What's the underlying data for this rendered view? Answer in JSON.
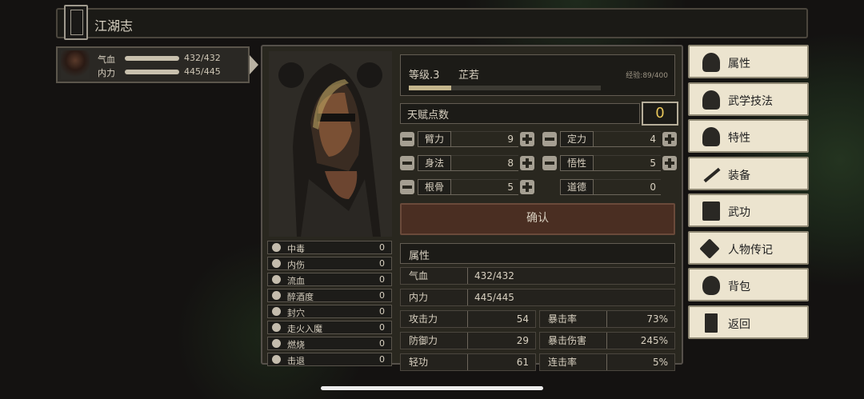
{
  "title": "江湖志",
  "character": {
    "hp_label": "气血",
    "hp_value": "432/432",
    "mp_label": "内力",
    "mp_value": "445/445"
  },
  "level": {
    "label": "等级.3",
    "name": "芷若",
    "exp": "经验:89/400",
    "exp_fraction": 0.2225
  },
  "talent": {
    "label": "天赋点数",
    "value": "0"
  },
  "attributes": [
    {
      "label": "臂力",
      "value": "9"
    },
    {
      "label": "定力",
      "value": "4"
    },
    {
      "label": "身法",
      "value": "8"
    },
    {
      "label": "悟性",
      "value": "5"
    },
    {
      "label": "根骨",
      "value": "5"
    },
    {
      "label": "道德",
      "value": "0"
    }
  ],
  "confirm": "确认",
  "section": "属性",
  "stats": {
    "hp_label": "气血",
    "hp": "432/432",
    "mp_label": "内力",
    "mp": "445/445",
    "attack_label": "攻击力",
    "attack": "54",
    "crit_label": "暴击率",
    "crit": "73%",
    "defense_label": "防御力",
    "defense": "29",
    "critdmg_label": "暴击伤害",
    "critdmg": "245%",
    "speed_label": "轻功",
    "speed": "61",
    "combo_label": "连击率",
    "combo": "5%"
  },
  "statuses": [
    {
      "name": "中毒",
      "value": "0"
    },
    {
      "name": "内伤",
      "value": "0"
    },
    {
      "name": "流血",
      "value": "0"
    },
    {
      "name": "醉酒度",
      "value": "0"
    },
    {
      "name": "封穴",
      "value": "0"
    },
    {
      "name": "走火入魔",
      "value": "0"
    },
    {
      "name": "燃烧",
      "value": "0"
    },
    {
      "name": "击退",
      "value": "0"
    }
  ],
  "menu": [
    "属性",
    "武学技法",
    "特性",
    "装备",
    "武功",
    "人物传记",
    "背包",
    "返回"
  ]
}
